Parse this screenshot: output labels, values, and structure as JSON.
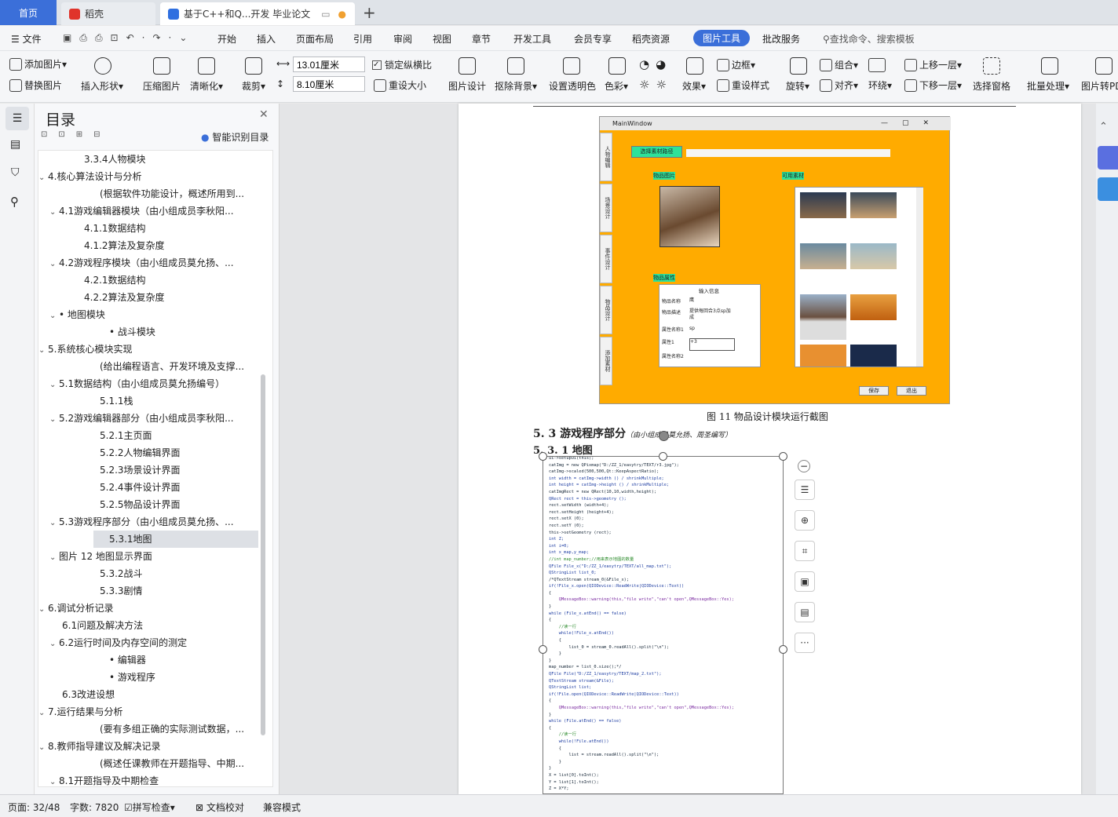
{
  "tabs": {
    "home": "首页",
    "t1": "稻壳",
    "t2": "基于C++和Q...开发 毕业论文"
  },
  "menu": {
    "file": "文件",
    "items": [
      "开始",
      "插入",
      "页面布局",
      "引用",
      "审阅",
      "视图",
      "章节",
      "开发工具",
      "会员专享",
      "稻壳资源"
    ],
    "active": "图片工具",
    "after": "批改服务",
    "search": "查找命令、搜索模板"
  },
  "ribbon": {
    "add_image": "添加图片",
    "replace_image": "替换图片",
    "insert_shape": "插入形状",
    "compress": "压缩图片",
    "clarity": "清晰化",
    "crop": "裁剪",
    "width": "13.01厘米",
    "height": "8.10厘米",
    "lock_ratio": "锁定纵横比",
    "reset_size": "重设大小",
    "image_design": "图片设计",
    "remove_bg": "抠除背景",
    "transparent": "设置透明色",
    "color": "色彩",
    "effect": "效果",
    "border": "边框",
    "reset_style": "重设样式",
    "rotate": "旋转",
    "group": "组合",
    "align": "对齐",
    "wrap": "环绕",
    "up_layer": "上移一层",
    "down_layer": "下移一层",
    "select_pane": "选择窗格",
    "batch": "批量处理",
    "to_pdf": "图片转PD"
  },
  "toc": {
    "title": "目录",
    "smart": "智能识别目录",
    "items": [
      {
        "t": "3.3.4人物模块",
        "lv": 3,
        "arrow": ""
      },
      {
        "t": "4.核心算法设计与分析",
        "lv": 1,
        "arrow": "v"
      },
      {
        "t": "(根据软件功能设计，概述所用到...",
        "lv": 4,
        "arrow": ""
      },
      {
        "t": "4.1游戏编辑器模块（由小组成员李秋阳...",
        "lv": 2,
        "arrow": "v"
      },
      {
        "t": "4.1.1数据结构",
        "lv": 3,
        "arrow": ""
      },
      {
        "t": "4.1.2算法及复杂度",
        "lv": 3,
        "arrow": ""
      },
      {
        "t": "4.2游戏程序模块（由小组成员莫允扬、...",
        "lv": 2,
        "arrow": "v"
      },
      {
        "t": "4.2.1数据结构",
        "lv": 3,
        "arrow": ""
      },
      {
        "t": "4.2.2算法及复杂度",
        "lv": 3,
        "arrow": ""
      },
      {
        "t": "• 地图模块",
        "lv": 2,
        "arrow": "v"
      },
      {
        "t": "• 战斗模块",
        "lv": 3.5,
        "arrow": ""
      },
      {
        "t": "5.系统核心模块实现",
        "lv": 1,
        "arrow": "v"
      },
      {
        "t": "(给出编程语言、开发环境及支撑...",
        "lv": 4,
        "arrow": ""
      },
      {
        "t": "5.1数据结构（由小组成员莫允扬编号）",
        "lv": 2,
        "arrow": "v"
      },
      {
        "t": "5.1.1栈",
        "lv": 4,
        "arrow": ""
      },
      {
        "t": "5.2游戏编辑器部分（由小组成员李秋阳...",
        "lv": 2,
        "arrow": "v"
      },
      {
        "t": "5.2.1主页面",
        "lv": 4,
        "arrow": ""
      },
      {
        "t": "5.2.2人物编辑界面",
        "lv": 4,
        "arrow": ""
      },
      {
        "t": "5.2.3场景设计界面",
        "lv": 4,
        "arrow": ""
      },
      {
        "t": "5.2.4事件设计界面",
        "lv": 4,
        "arrow": ""
      },
      {
        "t": "5.2.5物品设计界面",
        "lv": 4,
        "arrow": ""
      },
      {
        "t": "5.3游戏程序部分（由小组成员莫允扬、...",
        "lv": 2,
        "arrow": "v"
      },
      {
        "t": "5.3.1地图",
        "lv": 4,
        "arrow": "",
        "sel": true
      },
      {
        "t": "图片 12 地图显示界面",
        "lv": 2,
        "arrow": "v"
      },
      {
        "t": "5.3.2战斗",
        "lv": 4,
        "arrow": ""
      },
      {
        "t": "5.3.3剧情",
        "lv": 4,
        "arrow": ""
      },
      {
        "t": "6.调试分析记录",
        "lv": 1,
        "arrow": "v"
      },
      {
        "t": "6.1问题及解决方法",
        "lv": 2,
        "arrow": ""
      },
      {
        "t": "6.2运行时间及内存空间的测定",
        "lv": 2,
        "arrow": "v"
      },
      {
        "t": "• 编辑器",
        "lv": 3.5,
        "arrow": ""
      },
      {
        "t": "• 游戏程序",
        "lv": 3.5,
        "arrow": ""
      },
      {
        "t": "6.3改进设想",
        "lv": 2,
        "arrow": ""
      },
      {
        "t": "7.运行结果与分析",
        "lv": 1,
        "arrow": "v"
      },
      {
        "t": "(要有多组正确的实际测试数据，...",
        "lv": 4,
        "arrow": ""
      },
      {
        "t": "8.教师指导建议及解决记录",
        "lv": 1,
        "arrow": "v"
      },
      {
        "t": "(概述任课教师在开题指导、中期...",
        "lv": 4,
        "arrow": ""
      },
      {
        "t": "8.1开题指导及中期检查",
        "lv": 2,
        "arrow": "v"
      }
    ]
  },
  "doc": {
    "caption": "图 11 物品设计模块运行截图",
    "h53": "5. 3 游戏程序部分",
    "h53note": "（由小组成员莫允扬、周圣编写）",
    "h531": "5. 3. 1 地图"
  },
  "shot": {
    "title": "MainWindow",
    "btn_path": "选择素材路径",
    "lbl_img": "物品图片",
    "lbl_avail": "可用素材",
    "lbl_attr": "物品属性",
    "input_info": "输入信息",
    "rows": [
      [
        "物品名称",
        "鹰"
      ],
      [
        "物品描述",
        "提供每回合3点sp加成"
      ],
      [
        "属性名称1",
        "sp"
      ],
      [
        "属性1",
        "+3"
      ],
      [
        "属性名称2",
        ""
      ]
    ],
    "save": "保存",
    "exit": "退出",
    "tabs": [
      "人物编辑",
      "场景设计",
      "事件设计",
      "物品设计",
      "添加素材"
    ]
  },
  "code": [
    "ui->setupUi(this);",
    "catImg = new QPixmap(\"D:/ZZ_1/easytry/TEXT/r3.jpg\");",
    "catImg->scaled(500,500,Qt::KeepAspectRatio);",
    "int width = catImg->width () / shrinkMultiple;",
    "int height = catImg->height () / shrinkMultiple;",
    "catImgRect = new QRect(10,10,width,height);",
    "QRect rect = this->geometry ();",
    "rect.setWidth (width+4);",
    "rect.setHeight (height+4);",
    "rect.setX (0);",
    "rect.setY (0);",
    "this->setGeometry (rect);",
    "int Z;",
    "int i=0;",
    "int x_map,y_map;",
    "//int map_number;//用来表示地图的数量",
    "QFile File_x(\"D:/ZZ_1/easytry/TEXT/all_map.txt\");",
    "QStringList list_0;",
    "/*QTextStream stream_0(&File_x);",
    "if(!File_x.open(QIODevice::ReadWrite|QIODevice::Text))",
    "{",
    "    QMessageBox::warning(this,\"file write\",\"can't open\",QMessageBox::Yes);",
    "}",
    "while (File_x.atEnd() == false)",
    "{",
    "    //读一行",
    "    while(!File_x.atEnd())",
    "    {",
    "        list_0 = stream_0.readAll().split(\"\\n\");",
    "    }",
    "}",
    "map_number = list_0.size();*/",
    "QFile File(\"D:/ZZ_1/easytry/TEXT/map_2.txt\");",
    "QTextStream stream(&File);",
    "QStringList list;",
    "if(!File.open(QIODevice::ReadWrite|QIODevice::Text))",
    "{",
    "    QMessageBox::warning(this,\"file write\",\"can't open\",QMessageBox::Yes);",
    "}",
    "while (File.atEnd() == false)",
    "{",
    "    //读一行",
    "    while(!File.atEnd())",
    "    {",
    "        list = stream.readAll().split(\"\\n\");",
    "    }",
    "}",
    "X = list[0].toInt();",
    "Y = list[1].toInt();",
    "Z = X*Y;"
  ],
  "status": {
    "page": "页面: 32/48",
    "words": "字数: 7820",
    "spell": "拼写检查",
    "proof": "文档校对",
    "compat": "兼容模式"
  },
  "colors": {
    "accent": "#3b6fd9",
    "shot_bg": "#ffab00"
  }
}
